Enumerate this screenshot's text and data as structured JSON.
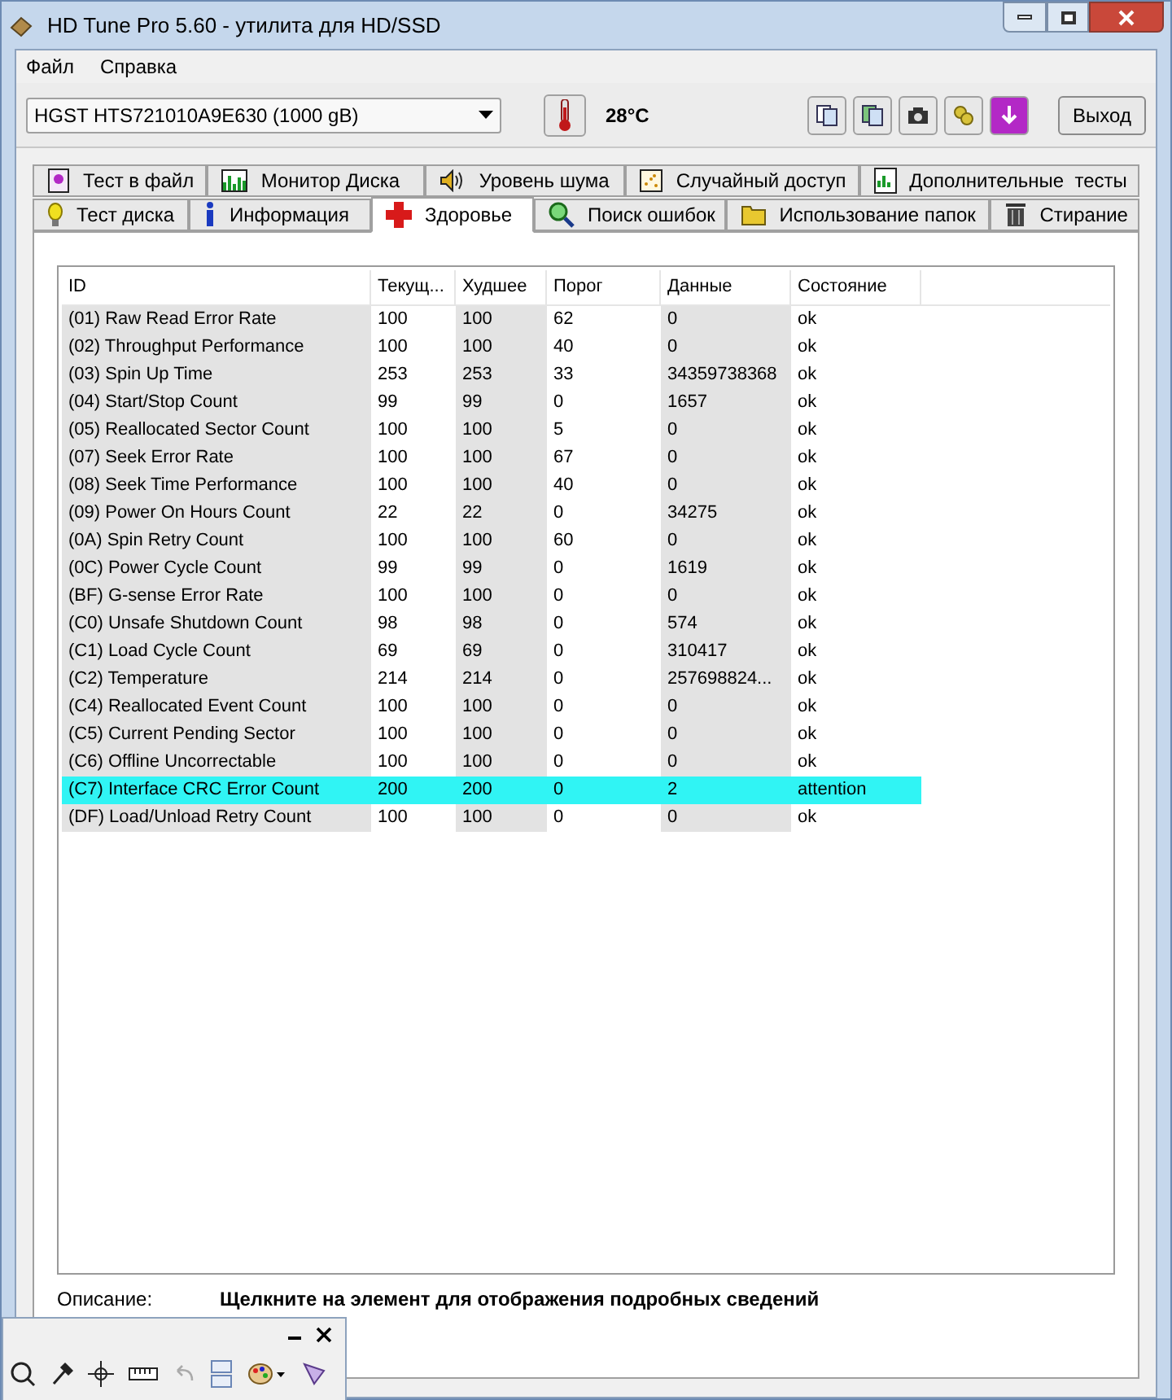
{
  "window": {
    "title": "HD Tune Pro 5.60 - утилита для HD/SSD"
  },
  "menu": [
    "Файл",
    "Справка"
  ],
  "toolbar": {
    "drive": "HGST HTS721010A9E630 (1000 gB)",
    "temperature": "28°C",
    "exit_button": "Выход"
  },
  "tabs_back": [
    {
      "label": "Тест в файл",
      "selected": false
    },
    {
      "label": "Монитор Диска",
      "selected": false
    },
    {
      "label": "Уровень шума",
      "selected": false
    },
    {
      "label": "Случайный доступ",
      "selected": false
    },
    {
      "label": "Дополнительные  тесты",
      "selected": false
    }
  ],
  "tabs_front": [
    {
      "label": "Тест диска",
      "selected": false
    },
    {
      "label": "Информация",
      "selected": false
    },
    {
      "label": "Здоровье",
      "selected": true
    },
    {
      "label": "Поиск ошибок",
      "selected": false
    },
    {
      "label": "Использование папок",
      "selected": false
    },
    {
      "label": "Стирание",
      "selected": false
    }
  ],
  "table": {
    "columns": [
      "ID",
      "Текущ...",
      "Худшее",
      "Порог",
      "Данные",
      "Состояние"
    ],
    "rows": [
      {
        "cells": [
          "(01) Raw Read Error Rate",
          "100",
          "100",
          "62",
          "0",
          "ok"
        ],
        "selected": false
      },
      {
        "cells": [
          "(02) Throughput Performance",
          "100",
          "100",
          "40",
          "0",
          "ok"
        ],
        "selected": false
      },
      {
        "cells": [
          "(03) Spin Up Time",
          "253",
          "253",
          "33",
          "34359738368",
          "ok"
        ],
        "selected": false
      },
      {
        "cells": [
          "(04) Start/Stop Count",
          "99",
          "99",
          "0",
          "1657",
          "ok"
        ],
        "selected": false
      },
      {
        "cells": [
          "(05) Reallocated Sector Count",
          "100",
          "100",
          "5",
          "0",
          "ok"
        ],
        "selected": false
      },
      {
        "cells": [
          "(07) Seek Error Rate",
          "100",
          "100",
          "67",
          "0",
          "ok"
        ],
        "selected": false
      },
      {
        "cells": [
          "(08) Seek Time Performance",
          "100",
          "100",
          "40",
          "0",
          "ok"
        ],
        "selected": false
      },
      {
        "cells": [
          "(09) Power On Hours Count",
          "22",
          "22",
          "0",
          "34275",
          "ok"
        ],
        "selected": false
      },
      {
        "cells": [
          "(0A) Spin Retry Count",
          "100",
          "100",
          "60",
          "0",
          "ok"
        ],
        "selected": false
      },
      {
        "cells": [
          "(0C) Power Cycle Count",
          "99",
          "99",
          "0",
          "1619",
          "ok"
        ],
        "selected": false
      },
      {
        "cells": [
          "(BF) G-sense Error Rate",
          "100",
          "100",
          "0",
          "0",
          "ok"
        ],
        "selected": false
      },
      {
        "cells": [
          "(C0) Unsafe Shutdown Count",
          "98",
          "98",
          "0",
          "574",
          "ok"
        ],
        "selected": false
      },
      {
        "cells": [
          "(C1) Load Cycle Count",
          "69",
          "69",
          "0",
          "310417",
          "ok"
        ],
        "selected": false
      },
      {
        "cells": [
          "(C2) Temperature",
          "214",
          "214",
          "0",
          "257698824...",
          "ok"
        ],
        "selected": false
      },
      {
        "cells": [
          "(C4) Reallocated Event Count",
          "100",
          "100",
          "0",
          "0",
          "ok"
        ],
        "selected": false
      },
      {
        "cells": [
          "(C5) Current Pending Sector",
          "100",
          "100",
          "0",
          "0",
          "ok"
        ],
        "selected": false
      },
      {
        "cells": [
          "(C6) Offline Uncorrectable",
          "100",
          "100",
          "0",
          "0",
          "ok"
        ],
        "selected": false
      },
      {
        "cells": [
          "(C7) Interface CRC Error Count",
          "200",
          "200",
          "0",
          "2",
          "attention"
        ],
        "selected": true
      },
      {
        "cells": [
          "(DF) Load/Unload Retry Count",
          "100",
          "100",
          "0",
          "0",
          "ok"
        ],
        "selected": false
      }
    ]
  },
  "description": {
    "label": "Описание:",
    "text": "Щелкните на элемент для отображения подробных сведений"
  }
}
